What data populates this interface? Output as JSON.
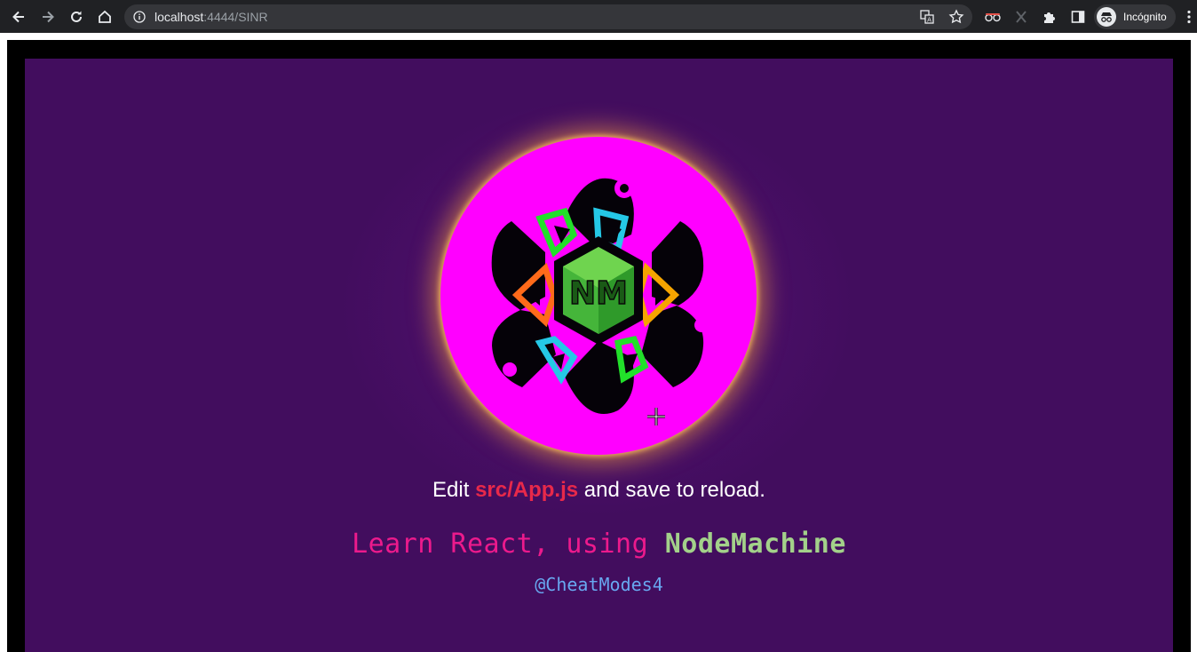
{
  "browser": {
    "url_host": "localhost",
    "url_rest": ":4444/SINR",
    "profile_label": "Incógnito",
    "icons": [
      "back-icon",
      "forward-icon",
      "reload-icon",
      "home-icon",
      "info-icon",
      "translate-icon",
      "star-icon",
      "incognito-glasses-icon",
      "x-extension-icon",
      "puzzle-icon",
      "sidepanel-icon",
      "more-icon"
    ]
  },
  "app": {
    "logo_text": "NM",
    "edit_prefix": "Edit ",
    "edit_code": "src/App.js",
    "edit_suffix": " and save to reload.",
    "learn_prefix": "Learn React, using ",
    "learn_strong": "NodeMachine",
    "handle": "@CheatModes4"
  },
  "colors": {
    "app_background": "#420d5e",
    "logo_disc": "#ff00ff",
    "code_accent": "#e8294a",
    "learn_text": "#ec1a8c",
    "learn_strong": "#a3d18a",
    "handle": "#68a8f0"
  }
}
